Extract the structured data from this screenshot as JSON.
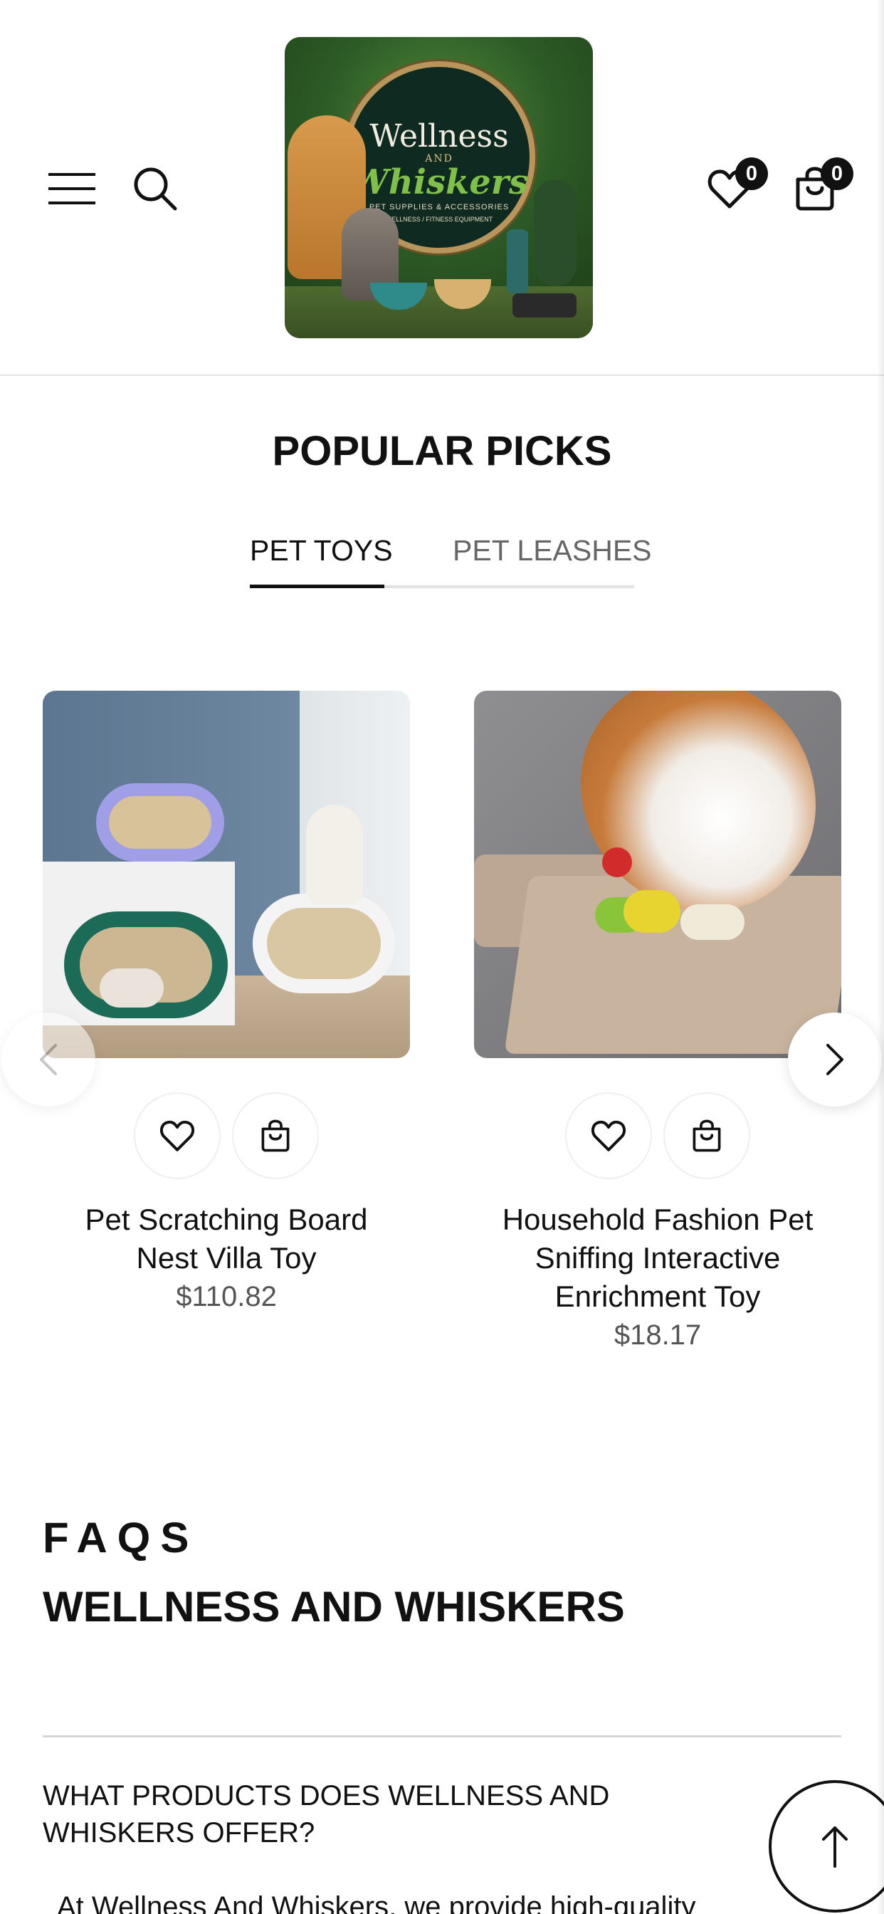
{
  "header": {
    "menu_icon": "hamburger-menu-icon",
    "search_icon": "search-icon",
    "logo": {
      "line1": "Wellness",
      "and": "AND",
      "line2": "Whiskers",
      "tagline": "PET SUPPLIES & ACCESSORIES",
      "tagline2": "WELLNESS / FITNESS EQUIPMENT"
    },
    "wishlist_count": "0",
    "cart_count": "0"
  },
  "popular": {
    "title": "POPULAR PICKS",
    "tabs": [
      {
        "label": "PET TOYS",
        "active": true
      },
      {
        "label": "PET LEASHES",
        "active": false
      }
    ],
    "products": [
      {
        "name_line1": "Pet Scratching Board",
        "name_line2": "Nest Villa Toy",
        "name_line3": "",
        "price": "$110.82"
      },
      {
        "name_line1": "Household Fashion Pet",
        "name_line2": "Sniffing Interactive",
        "name_line3": "Enrichment Toy",
        "price": "$18.17"
      }
    ]
  },
  "faq": {
    "title": "FAQS",
    "subtitle": "WELLNESS AND WHISKERS",
    "question_line1": "WHAT PRODUCTS DOES WELLNESS AND",
    "question_line2": "WHISKERS OFFER?",
    "answer_start": "At Wellness And Whiskers, we provide high-quality"
  },
  "colors": {
    "text": "#111111",
    "muted": "#666666",
    "divider": "#e2e2e2",
    "badge": "#111111"
  }
}
